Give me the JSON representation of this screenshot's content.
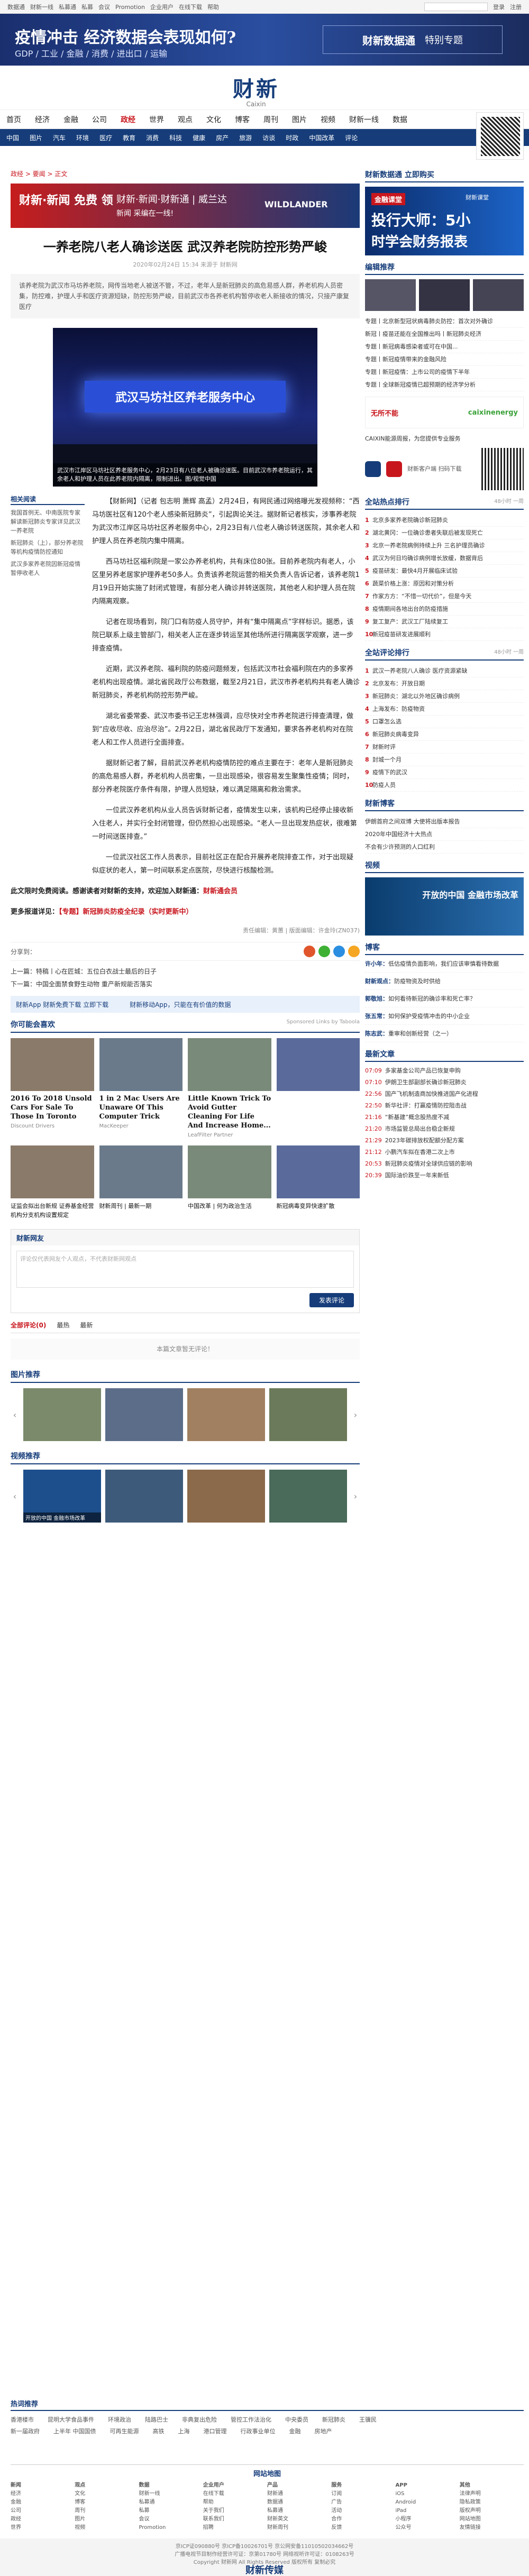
{
  "topbar": {
    "links": [
      "数据通",
      "财新一线",
      "私募通",
      "私募",
      "会议",
      "Promotion",
      "企业用户",
      "在线下载",
      "帮助"
    ],
    "login": "登录",
    "register": "注册"
  },
  "banner": {
    "title": "疫情冲击 经济数据会表现如何?",
    "subtitle": "GDP / 工业 / 金融 / 消费 / 进出口 / 运输",
    "brand": "财新数据通",
    "tag": "特别专题"
  },
  "logo": {
    "cn": "财新",
    "en": "Caixin"
  },
  "nav": [
    "首页",
    "经济",
    "金融",
    "公司",
    "政经",
    "世界",
    "观点",
    "文化",
    "博客",
    "周刊",
    "图片",
    "视频",
    "财新一线",
    "数据"
  ],
  "nav_active": "政经",
  "subnav": [
    "中国",
    "图片",
    "汽车",
    "环境",
    "医疗",
    "教育",
    "消费",
    "科技",
    "健康",
    "房产",
    "旅游",
    "访谈",
    "时政",
    "中国改革",
    "评论"
  ],
  "crumb": "政经 > 要闻 > 正文",
  "adbar": {
    "a1": "财新·新闻 免费 领",
    "a2": "财新·新闻·财新通 | 威兰达",
    "a3": "新闻 采编在一线!",
    "a4": "WILDLANDER"
  },
  "article": {
    "title": "一养老院八老人确诊送医 武汉养老院防控形势严峻",
    "meta": "2020年02月24日 15:34 来源于 财新网",
    "summary": "该养老院为武汉市马坊养老院，网传当地老人被送不管，不过，老年人是新冠肺炎的高危易感人群，养老机构人员密集，防控难，护理人手和医疗资源短缺，防控形势严峻，目前武汉市各养老机构暂停收老人新接收的情况，只接产康复医疗",
    "photo_sign": "武汉马坊社区养老服务中心",
    "caption": "武汉市江岸区马坊社区养老服务中心，2月23日有八位老人被确诊送医。目前武汉市养老院运行，其余老人和护理人员在此养老院内隔离，限制进出。图/视觉中国",
    "related_head": "相关阅读",
    "related": [
      "我国首例无、中南医院专家解读新冠肺炎专家详见武汉一养老院",
      "新冠肺炎（上），部分养老院等机构疫情防控通知",
      "武汉多家养老院因新冠疫情暂停收老人"
    ],
    "paragraphs": [
      "【财新网】（记者 包志明 萧辉 高孟）2月24日，有网民通过网络曝光发视频称：“西马坊医社区有120个老人感染新冠肺炎”，引起舆论关注。据财新记者核实，涉事养老院为武汉市江岸区马坊社区养老服务中心，2月23日有八位老人确诊转送医院，其余老人和护理人员在养老院内集中隔离。",
      "西马坊社区福利院是一家公办养老机构，共有床位80张。目前养老院内有老人，小区里另养老居家护理养老50多人。负责该养老院运营的相关负责人告诉记者，该养老院1月19日开始实施了封闭式管理，有部分老人确诊并转送医院，其他老人和护理人员在院内隔离观察。",
      "记者在现场看到，院门口有防疫人员守护，并有“集中隔离点”字样标识。据悉，该院已联系上级主管部门，相关老人正在逐步转运至其他场所进行隔离医学观察，进一步排查疫情。",
      "近期，武汉养老院、福利院的防疫问题频发，包括武汉市社会福利院在内的多家养老机构出现疫情。湖北省民政厅公布数据，截至2月21日，武汉市养老机构共有老人确诊新冠肺炎，养老机构防控形势严峻。",
      "湖北省委常委、武汉市委书记王忠林强调，应尽快对全市养老院进行排查清理，做到“应收尽收、应治尽治”。2月22日，湖北省民政厅下发通知，要求各养老机构对在院老人和工作人员进行全面排查。",
      "据财新记者了解，目前武汉养老机构疫情防控的难点主要在于：老年人是新冠肺炎的高危易感人群，养老机构人员密集，一旦出现感染，很容易发生聚集性疫情；同时，部分养老院医疗条件有限，护理人员短缺，难以满足隔离和救治需求。",
      "一位武汉养老机构从业人员告诉财新记者，疫情发生以来，该机构已经停止接收新入住老人，并实行全封闭管理，但仍然担心出现感染。“老人一旦出现发热症状，很难第一时间送医排查。”",
      "一位武汉社区工作人员表示，目前社区正在配合开展养老院排查工作，对于出现疑似症状的老人，第一时间联系定点医院，尽快进行核酸检测。"
    ],
    "hot_label": "此文限时免费阅读。感谢读者对财新的支持，欢迎加入财新通：",
    "hot_link": "财新通会员",
    "topic_label": "更多报道详见：",
    "topic": "【专题】新冠肺炎防疫全纪录（实时更新中）",
    "editor": "责任编辑：黄蕙 | 版面编辑：许金玲(ZN037)"
  },
  "share_label": "分享到：",
  "prev": "上一篇：特稿丨心在匠城：五位白衣战士最后的日子",
  "next": "下一篇：中国全面禁食野生动物 重产新规能否落实",
  "app_bar": [
    "财新App 财新免费下载 立即下载",
    "财新移动App，只能在有价值的数据"
  ],
  "recommend_head": "你可能会喜欢",
  "recommend_note": "Sponsored Links by Taboola",
  "recommend": [
    {
      "t": "2016 To 2018 Unsold Cars For Sale To Those In Toronto",
      "s": "Discount Drivers"
    },
    {
      "t": "1 in 2 Mac Users Are Unaware Of This Computer Trick",
      "s": "MacKeeper"
    },
    {
      "t": "Little Known Trick To Avoid Gutter Cleaning For Life And Increase Home...",
      "s": "LeafFilter Partner"
    },
    {
      "t": "",
      "s": ""
    }
  ],
  "recommend2": [
    {
      "t": "证监会拟出台新规 证券基金经营机构分支机构设置规定",
      "s": ""
    },
    {
      "t": "财新周刊 | 最新一期",
      "s": ""
    },
    {
      "t": "中国改革 | 何为政治生活",
      "s": ""
    },
    {
      "t": "新冠病毒变异快速扩散",
      "s": ""
    }
  ],
  "comment": {
    "head": "财新网友",
    "placeholder": "评论仅代表网友个人观点，不代表财新网观点",
    "btn": "发表评论",
    "tabs": [
      "全部评论(0)",
      "最热",
      "最新"
    ],
    "empty": "本篇文章暂无评论！"
  },
  "photo_head": "图片推荐",
  "video_head": "视频推荐",
  "photos": [
    "",
    "",
    "",
    ""
  ],
  "videos": [
    "开放的中国 金融市场改革",
    "",
    "",
    ""
  ],
  "side": {
    "reader": "财新数据通 立即购买",
    "ad_label": "金融课堂",
    "ad_t1": "投行大师：5小",
    "ad_t2": "时学会财务报表",
    "ad_small": "财新课堂",
    "sect1": "编辑推荐",
    "sect1_items": [
      "专题丨北京新型冠状病毒肺炎防控：首次对外确诊",
      "新冠丨疫苗还能在全国推出吗丨新冠肺炎经济",
      "专题丨新冠病毒感染者或可在中国...",
      "专题丨新冠疫情带来的金融风险",
      "专题丨新冠疫情：上市公司的疫情下半年",
      "专题丨全球新冠疫情已超预期的经济学分析"
    ],
    "ad2_l": "无所不能",
    "ad2_r": "caixinenergy",
    "ad2_sub": "CAIXIN能源周报，为您提供专业服务",
    "app_txt": "财新客户端 扫码下载",
    "sect2": "全站热点排行",
    "sect2_more": "48小时 一周",
    "sect2_items": [
      "北京多家养老院确诊新冠肺炎",
      "湖北黄冈：一位确诊患者失联后被发现死亡",
      "北京一养老院病例持续上升 三名护理员确诊",
      "武汉为何日均确诊病例增长放缓，数据背后",
      "疫苗研发：最快4月开展临床试验",
      "蔬菜价格上涨：原因和对策分析",
      "作家方方：“不惜一切代价”，但是今天",
      "疫情期间各地出台的防疫措施",
      "复工复产：武汉工厂陆续复工",
      "新冠疫苗研发进展顺利"
    ],
    "sect3": "全站评论排行",
    "sect3_more": "48小时 一周",
    "sect3_items": [
      "武汉一养老院八人确诊 医疗资源紧缺",
      "北京发布：开放日期",
      "新冠肺炎：湖北以外地区确诊病例",
      "上海发布：防疫物资",
      "口罩怎么选",
      "新冠肺炎病毒变异",
      "财新时评",
      "封城一个月",
      "疫情下的武汉",
      "防疫人员"
    ],
    "sect4": "财新博客",
    "sect4_items": [
      "伊朗首府之间双博 大使将出版本报告",
      "2020年中国经济十大热点",
      "不会有少许预测的人口红利"
    ],
    "sect5": "视频",
    "sect5_label": "开放的中国 金融市场改革",
    "sect6": "博客",
    "blog": [
      {
        "a": "许小年：",
        "t": "低估疫情负面影响，我们应该审慎看待数据"
      },
      {
        "a": "财新观点：",
        "t": "防疫物资及时供给"
      },
      {
        "a": "郭敬旭：",
        "t": "如何看待新冠的确诊率和死亡率？"
      },
      {
        "a": "张五常：",
        "t": "如何保护受疫情冲击的中小企业"
      },
      {
        "a": "陈志武：",
        "t": "重审和创新经营（之一）"
      }
    ],
    "sect7": "最新文章",
    "news": [
      {
        "tm": "07:09",
        "t": "多家基金公司产品已恢复申购"
      },
      {
        "tm": "07:10",
        "t": "伊朗卫生部副部长确诊新冠肺炎"
      },
      {
        "tm": "22:56",
        "t": "国产飞机制造商加快推进国产化进程"
      },
      {
        "tm": "22:50",
        "t": "新华社评：打赢疫情防控阻击战"
      },
      {
        "tm": "21:16",
        "t": "“新基建”概念股热度不减"
      },
      {
        "tm": "21:20",
        "t": "市场监管总局出台稳企新规"
      },
      {
        "tm": "21:29",
        "t": "2023年碳排放权配额分配方案"
      },
      {
        "tm": "21:12",
        "t": "小鹏汽车拟在香港二次上市"
      },
      {
        "tm": "20:53",
        "t": "新冠肺炎疫情对全球供应链的影响"
      },
      {
        "tm": "20:39",
        "t": "国际油价跌至一年来新低"
      }
    ]
  },
  "hotwords": {
    "head": "热词推荐",
    "row1": [
      "香港楼市",
      "昆明大学食品事件",
      "环境政治",
      "陆路巴士",
      "非典复出危险",
      "管控工作法治化",
      "中央委员",
      "新冠肺炎",
      "王骥民"
    ],
    "row2": [
      "新一届政府",
      "上半年 中国国债",
      "可再生能源",
      "高铁",
      "上海",
      "港口管理",
      "行政事业单位",
      "金融",
      "房地产"
    ]
  },
  "sitenav": {
    "head": "网站地图",
    "cols": [
      [
        "新闻",
        "经济",
        "金融",
        "公司",
        "政经",
        "世界"
      ],
      [
        "观点",
        "文化",
        "博客",
        "周刊",
        "图片",
        "视频"
      ],
      [
        "数据",
        "财新一线",
        "私募通",
        "私募",
        "会议",
        "Promotion"
      ],
      [
        "企业用户",
        "在线下载",
        "帮助",
        "关于我们",
        "联系我们",
        "招聘"
      ],
      [
        "产品",
        "财新通",
        "数据通",
        "私募通",
        "财新英文",
        "财新周刊"
      ],
      [
        "服务",
        "订阅",
        "广告",
        "活动",
        "合作",
        "反馈"
      ],
      [
        "APP",
        "iOS",
        "Android",
        "iPad",
        "小程序",
        "公众号"
      ],
      [
        "其他",
        "法律声明",
        "隐私政策",
        "版权声明",
        "网站地图",
        "友情链接"
      ]
    ]
  },
  "footer": {
    "line1": "京ICP证090880号 京ICP备10026701号 京公网安备11010502034662号",
    "line2": "广播电视节目制作经营许可证：京第01780号 网络视听许可证：0108263号",
    "line3": "Copyright 财新网 All Rights Reserved 版权所有 复制必究",
    "logo": "财新传媒"
  }
}
